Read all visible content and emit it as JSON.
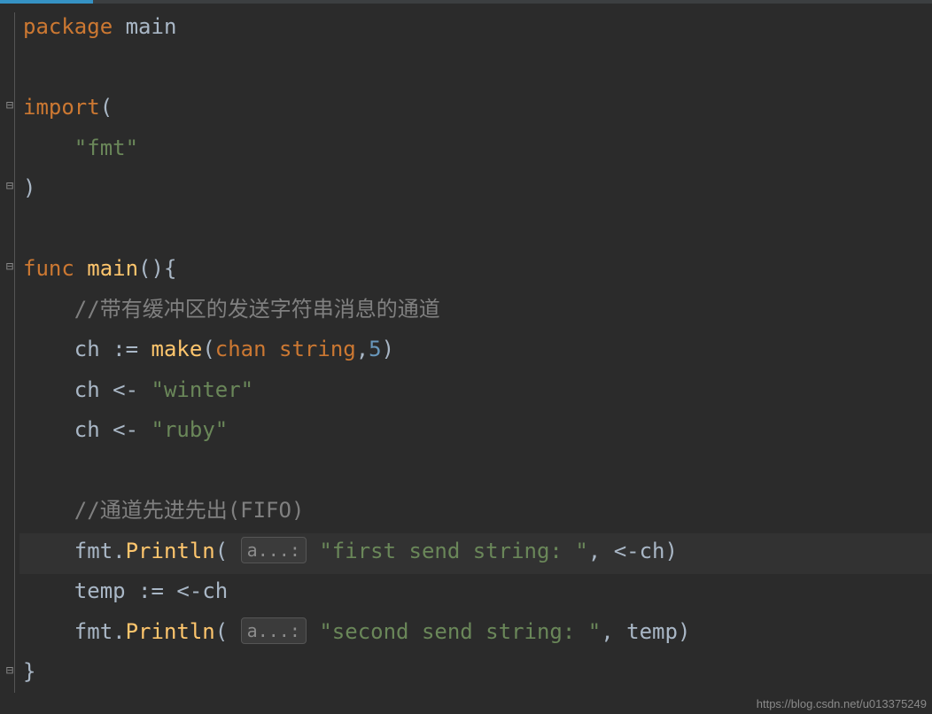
{
  "colors": {
    "background": "#2b2b2b",
    "keyword": "#cc7832",
    "string": "#6a8759",
    "comment": "#808080",
    "function": "#ffc66d",
    "number": "#6897bb",
    "default": "#a9b7c6",
    "progress": "#3592c4"
  },
  "progress": {
    "percent": 10
  },
  "watermark": "https://blog.csdn.net/u013375249",
  "code": {
    "l1": {
      "kw_package": "package",
      "pkg": "main"
    },
    "l3": {
      "kw_import": "import",
      "paren_open": "("
    },
    "l4": {
      "str_fmt": "\"fmt\""
    },
    "l5": {
      "paren_close": ")"
    },
    "l7": {
      "kw_func": "func",
      "fn_main": "main",
      "parens": "()",
      "brace": "{"
    },
    "l8": {
      "comment": "//带有缓冲区的发送字符串消息的通道"
    },
    "l9": {
      "ch": "ch",
      "assign": ":=",
      "make": "make",
      "paren_open": "(",
      "kw_chan": "chan",
      "kw_string": "string",
      "comma": ",",
      "num": "5",
      "paren_close": ")"
    },
    "l10": {
      "ch": "ch",
      "arrow": "<-",
      "str": "\"winter\""
    },
    "l11": {
      "ch": "ch",
      "arrow": "<-",
      "str": "\"ruby\""
    },
    "l13": {
      "comment": "//通道先进先出(FIFO)"
    },
    "l14": {
      "pkg": "fmt",
      "dot": ".",
      "fn": "Println",
      "paren_open": "(",
      "hint": "a...:",
      "str": "\"first send string: \"",
      "comma": ",",
      "arrow": "<-",
      "ch": "ch",
      "paren_close": ")"
    },
    "l15": {
      "temp": "temp",
      "assign": ":=",
      "arrow": "<-",
      "ch": "ch"
    },
    "l16": {
      "pkg": "fmt",
      "dot": ".",
      "fn": "Println",
      "paren_open": "(",
      "hint": "a...:",
      "str": "\"second send string: \"",
      "comma": ",",
      "temp": "temp",
      "paren_close": ")"
    },
    "l17": {
      "brace_close": "}"
    }
  }
}
